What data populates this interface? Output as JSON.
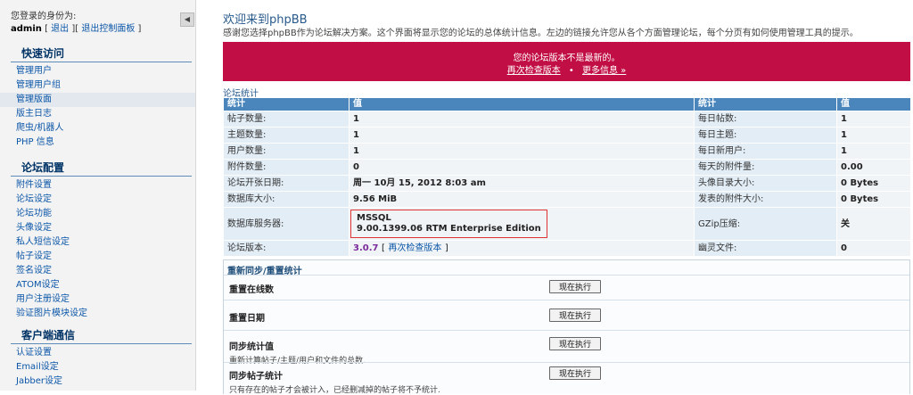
{
  "sidebar": {
    "login_label": "您登录的身份为:",
    "username": "admin",
    "logout": "退出",
    "exit_panel": "退出控制面板",
    "collapse_icon": "◀",
    "sections": [
      {
        "title": "快速访问",
        "items": [
          "管理用户",
          "管理用户组",
          "管理版面",
          "版主日志",
          "爬虫/机器人",
          "PHP 信息"
        ]
      },
      {
        "title": "论坛配置",
        "items": [
          "附件设置",
          "论坛设定",
          "论坛功能",
          "头像设定",
          "私人短信设定",
          "帖子设定",
          "签名设定",
          "ATOM设定",
          "用户注册设定",
          "验证图片模块设定"
        ]
      },
      {
        "title": "客户端通信",
        "items": [
          "认证设置",
          "Email设定",
          "Jabber设定"
        ]
      }
    ]
  },
  "main": {
    "title": "欢迎来到phpBB",
    "intro": "感谢您选择phpBB作为论坛解决方案。这个界面将显示您的论坛的总体统计信息。左边的链接允许您从各个方面管理论坛，每个分页有如何使用管理工具的提示。",
    "alert": {
      "message": "您的论坛版本不是最新的。",
      "recheck": "再次检查版本",
      "separator": "•",
      "more": "更多信息 »"
    },
    "stats_caption": "论坛统计",
    "stats_headers": [
      "统计",
      "值",
      "统计",
      "值"
    ],
    "stats_rows": [
      {
        "l1": "帖子数量:",
        "v1": "1",
        "l2": "每日帖数:",
        "v2": "1"
      },
      {
        "l1": "主题数量:",
        "v1": "1",
        "l2": "每日主题:",
        "v2": "1"
      },
      {
        "l1": "用户数量:",
        "v1": "1",
        "l2": "每日新用户:",
        "v2": "1"
      },
      {
        "l1": "附件数量:",
        "v1": "0",
        "l2": "每天的附件量:",
        "v2": "0.00"
      },
      {
        "l1": "论坛开张日期:",
        "v1": "周一 10月 15, 2012 8:03 am",
        "l2": "头像目录大小:",
        "v2": "0 Bytes"
      },
      {
        "l1": "数据库大小:",
        "v1": "9.56 MiB",
        "l2": "发表的附件大小:",
        "v2": "0 Bytes"
      }
    ],
    "db_row": {
      "label": "数据库服务器:",
      "line1": "MSSQL",
      "line2": "9.00.1399.06 RTM Enterprise Edition",
      "l2": "GZip压缩:",
      "v2": "关"
    },
    "version_row": {
      "label": "论坛版本:",
      "version": "3.0.7",
      "open": "[",
      "link": "再次检查版本",
      "close": "]",
      "l2": "幽灵文件:",
      "v2": "0"
    },
    "resync": {
      "title": "重新同步/重置统计",
      "button_label": "现在执行",
      "rows": [
        {
          "title": "重置在线数",
          "desc": ""
        },
        {
          "title": "重置日期",
          "desc": ""
        },
        {
          "title": "同步统计值",
          "desc": "重新计算帖子/主题/用户和文件的总数."
        },
        {
          "title": "同步帖子统计",
          "desc": "只有存在的帖子才会被计入，已经删减掉的帖子将不予统计."
        }
      ]
    }
  }
}
